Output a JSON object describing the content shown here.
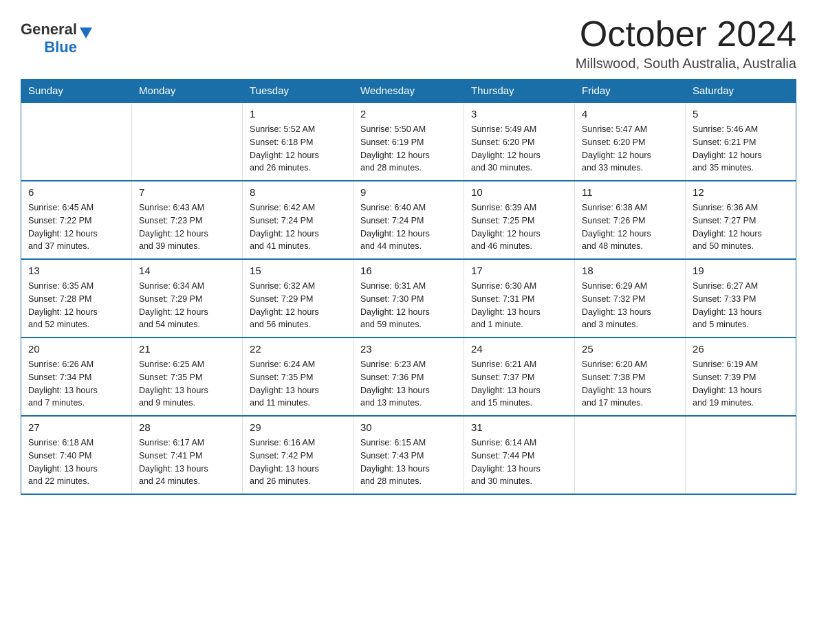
{
  "header": {
    "logo_general": "General",
    "logo_blue": "Blue",
    "month_title": "October 2024",
    "location": "Millswood, South Australia, Australia"
  },
  "days_of_week": [
    "Sunday",
    "Monday",
    "Tuesday",
    "Wednesday",
    "Thursday",
    "Friday",
    "Saturday"
  ],
  "weeks": [
    [
      {
        "day": "",
        "info": ""
      },
      {
        "day": "",
        "info": ""
      },
      {
        "day": "1",
        "info": "Sunrise: 5:52 AM\nSunset: 6:18 PM\nDaylight: 12 hours\nand 26 minutes."
      },
      {
        "day": "2",
        "info": "Sunrise: 5:50 AM\nSunset: 6:19 PM\nDaylight: 12 hours\nand 28 minutes."
      },
      {
        "day": "3",
        "info": "Sunrise: 5:49 AM\nSunset: 6:20 PM\nDaylight: 12 hours\nand 30 minutes."
      },
      {
        "day": "4",
        "info": "Sunrise: 5:47 AM\nSunset: 6:20 PM\nDaylight: 12 hours\nand 33 minutes."
      },
      {
        "day": "5",
        "info": "Sunrise: 5:46 AM\nSunset: 6:21 PM\nDaylight: 12 hours\nand 35 minutes."
      }
    ],
    [
      {
        "day": "6",
        "info": "Sunrise: 6:45 AM\nSunset: 7:22 PM\nDaylight: 12 hours\nand 37 minutes."
      },
      {
        "day": "7",
        "info": "Sunrise: 6:43 AM\nSunset: 7:23 PM\nDaylight: 12 hours\nand 39 minutes."
      },
      {
        "day": "8",
        "info": "Sunrise: 6:42 AM\nSunset: 7:24 PM\nDaylight: 12 hours\nand 41 minutes."
      },
      {
        "day": "9",
        "info": "Sunrise: 6:40 AM\nSunset: 7:24 PM\nDaylight: 12 hours\nand 44 minutes."
      },
      {
        "day": "10",
        "info": "Sunrise: 6:39 AM\nSunset: 7:25 PM\nDaylight: 12 hours\nand 46 minutes."
      },
      {
        "day": "11",
        "info": "Sunrise: 6:38 AM\nSunset: 7:26 PM\nDaylight: 12 hours\nand 48 minutes."
      },
      {
        "day": "12",
        "info": "Sunrise: 6:36 AM\nSunset: 7:27 PM\nDaylight: 12 hours\nand 50 minutes."
      }
    ],
    [
      {
        "day": "13",
        "info": "Sunrise: 6:35 AM\nSunset: 7:28 PM\nDaylight: 12 hours\nand 52 minutes."
      },
      {
        "day": "14",
        "info": "Sunrise: 6:34 AM\nSunset: 7:29 PM\nDaylight: 12 hours\nand 54 minutes."
      },
      {
        "day": "15",
        "info": "Sunrise: 6:32 AM\nSunset: 7:29 PM\nDaylight: 12 hours\nand 56 minutes."
      },
      {
        "day": "16",
        "info": "Sunrise: 6:31 AM\nSunset: 7:30 PM\nDaylight: 12 hours\nand 59 minutes."
      },
      {
        "day": "17",
        "info": "Sunrise: 6:30 AM\nSunset: 7:31 PM\nDaylight: 13 hours\nand 1 minute."
      },
      {
        "day": "18",
        "info": "Sunrise: 6:29 AM\nSunset: 7:32 PM\nDaylight: 13 hours\nand 3 minutes."
      },
      {
        "day": "19",
        "info": "Sunrise: 6:27 AM\nSunset: 7:33 PM\nDaylight: 13 hours\nand 5 minutes."
      }
    ],
    [
      {
        "day": "20",
        "info": "Sunrise: 6:26 AM\nSunset: 7:34 PM\nDaylight: 13 hours\nand 7 minutes."
      },
      {
        "day": "21",
        "info": "Sunrise: 6:25 AM\nSunset: 7:35 PM\nDaylight: 13 hours\nand 9 minutes."
      },
      {
        "day": "22",
        "info": "Sunrise: 6:24 AM\nSunset: 7:35 PM\nDaylight: 13 hours\nand 11 minutes."
      },
      {
        "day": "23",
        "info": "Sunrise: 6:23 AM\nSunset: 7:36 PM\nDaylight: 13 hours\nand 13 minutes."
      },
      {
        "day": "24",
        "info": "Sunrise: 6:21 AM\nSunset: 7:37 PM\nDaylight: 13 hours\nand 15 minutes."
      },
      {
        "day": "25",
        "info": "Sunrise: 6:20 AM\nSunset: 7:38 PM\nDaylight: 13 hours\nand 17 minutes."
      },
      {
        "day": "26",
        "info": "Sunrise: 6:19 AM\nSunset: 7:39 PM\nDaylight: 13 hours\nand 19 minutes."
      }
    ],
    [
      {
        "day": "27",
        "info": "Sunrise: 6:18 AM\nSunset: 7:40 PM\nDaylight: 13 hours\nand 22 minutes."
      },
      {
        "day": "28",
        "info": "Sunrise: 6:17 AM\nSunset: 7:41 PM\nDaylight: 13 hours\nand 24 minutes."
      },
      {
        "day": "29",
        "info": "Sunrise: 6:16 AM\nSunset: 7:42 PM\nDaylight: 13 hours\nand 26 minutes."
      },
      {
        "day": "30",
        "info": "Sunrise: 6:15 AM\nSunset: 7:43 PM\nDaylight: 13 hours\nand 28 minutes."
      },
      {
        "day": "31",
        "info": "Sunrise: 6:14 AM\nSunset: 7:44 PM\nDaylight: 13 hours\nand 30 minutes."
      },
      {
        "day": "",
        "info": ""
      },
      {
        "day": "",
        "info": ""
      }
    ]
  ]
}
